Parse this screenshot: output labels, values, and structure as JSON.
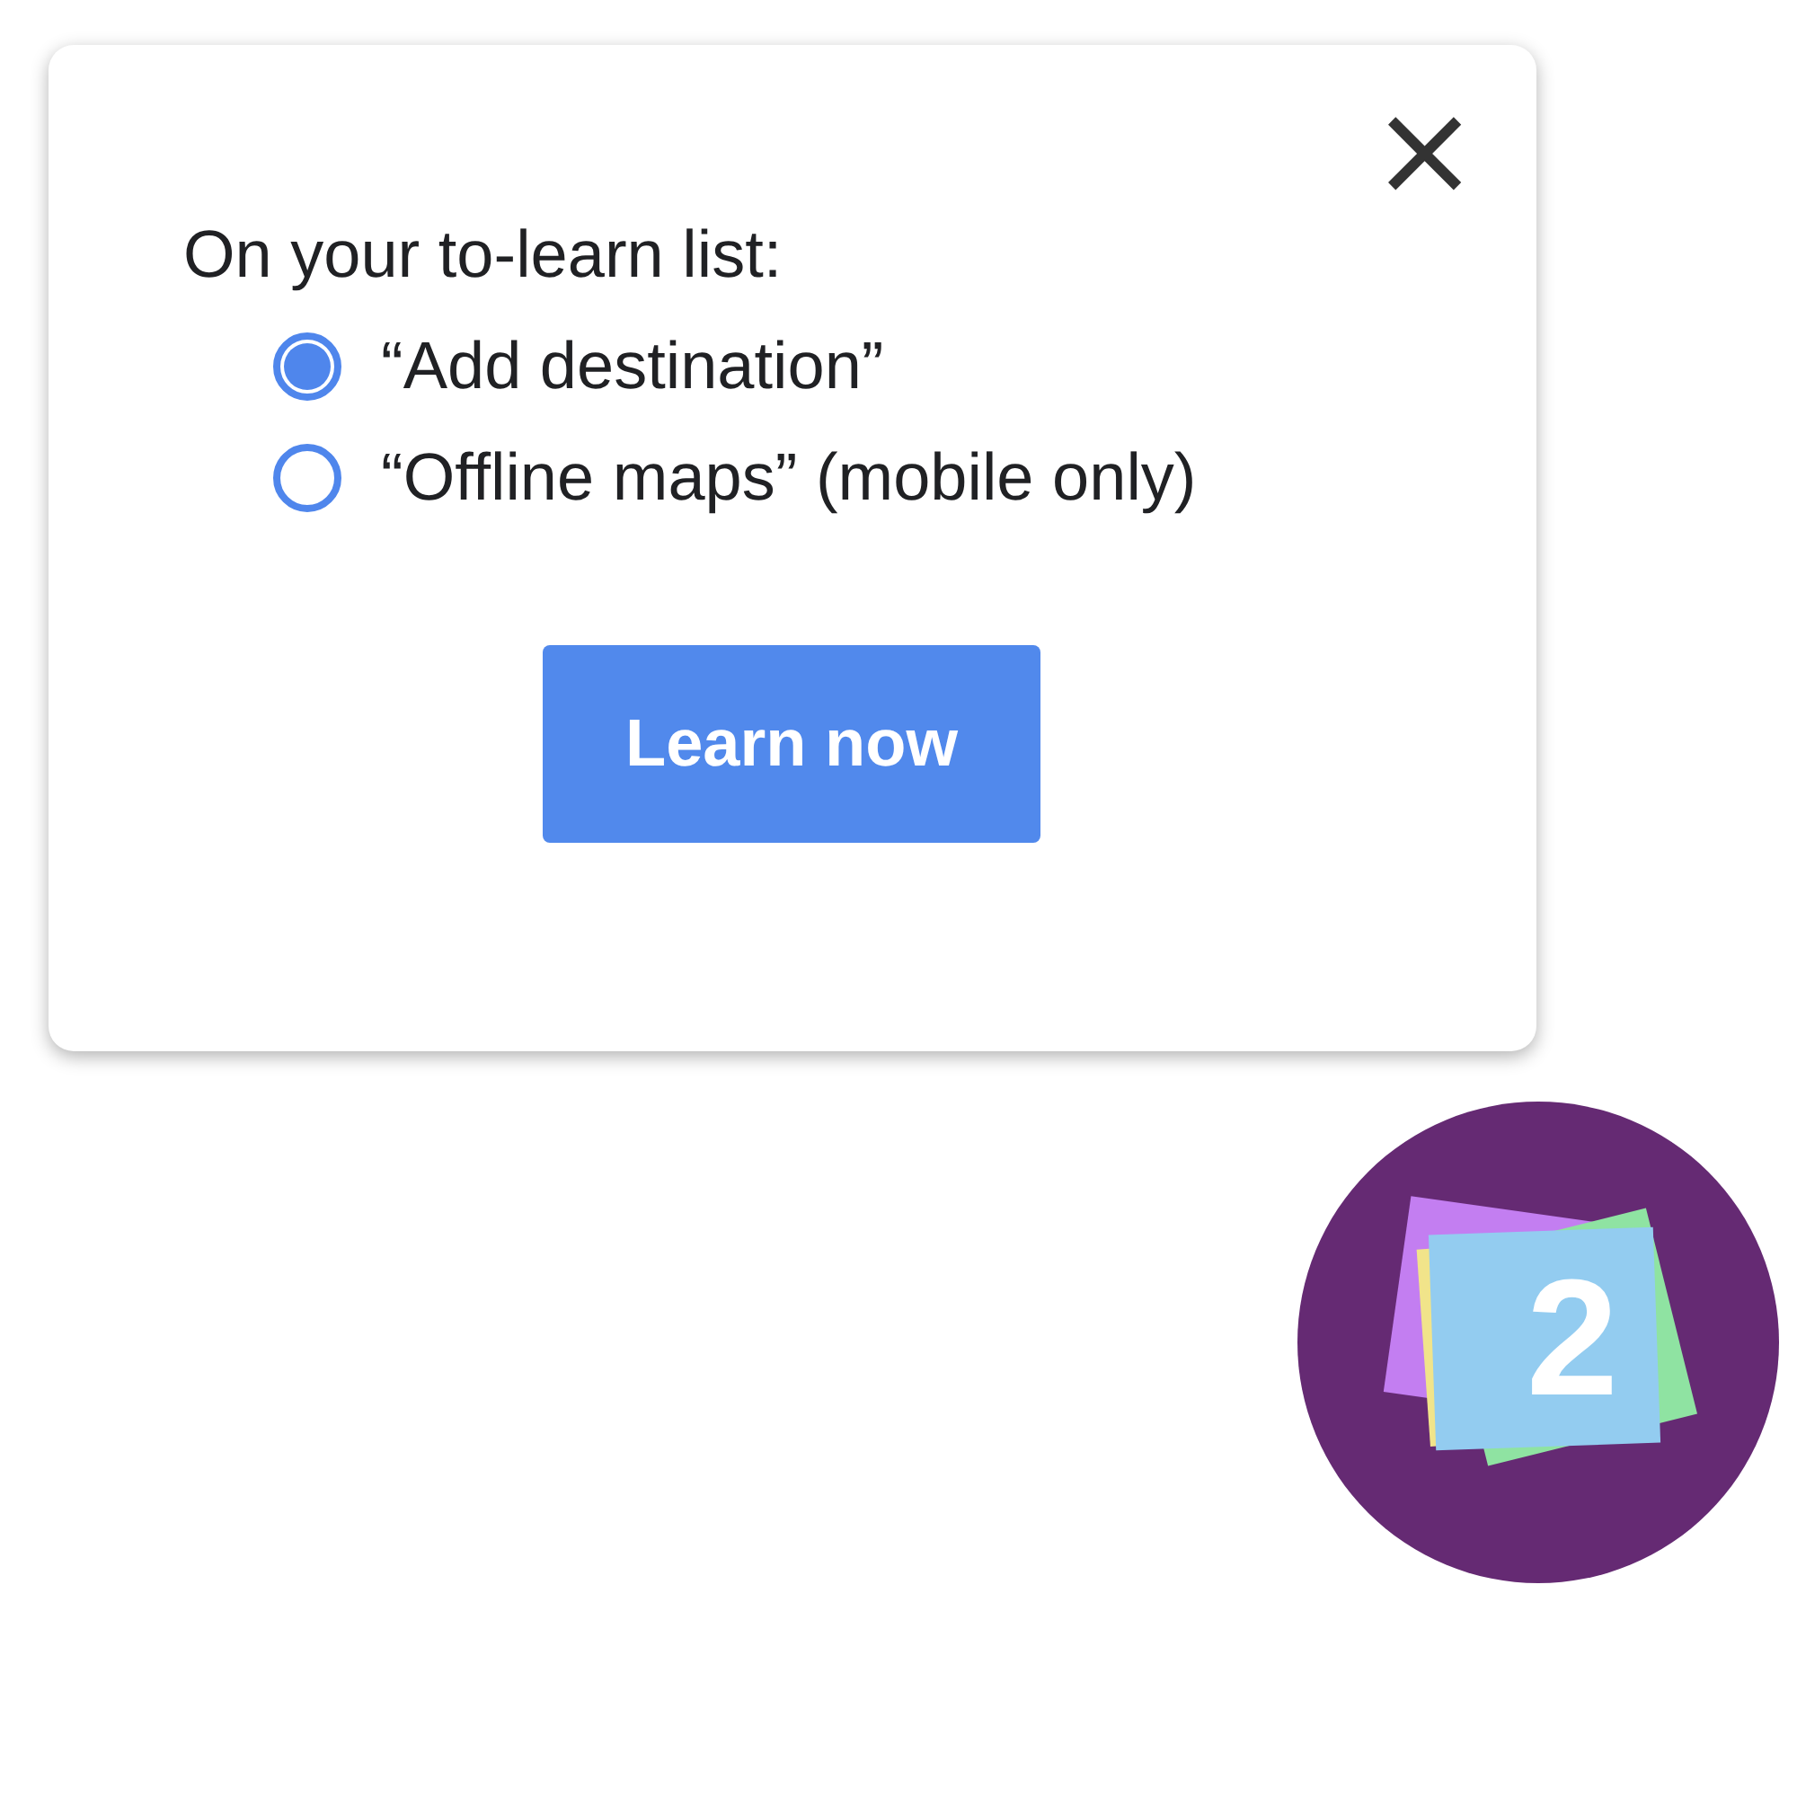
{
  "popup": {
    "close": "×",
    "heading": "On your to-learn list:",
    "options": [
      {
        "label": "“Add destination”",
        "selected": true
      },
      {
        "label": "“Offline maps” (mobile only)",
        "selected": false
      }
    ],
    "button": "Learn now"
  },
  "badge": {
    "count": "2"
  }
}
